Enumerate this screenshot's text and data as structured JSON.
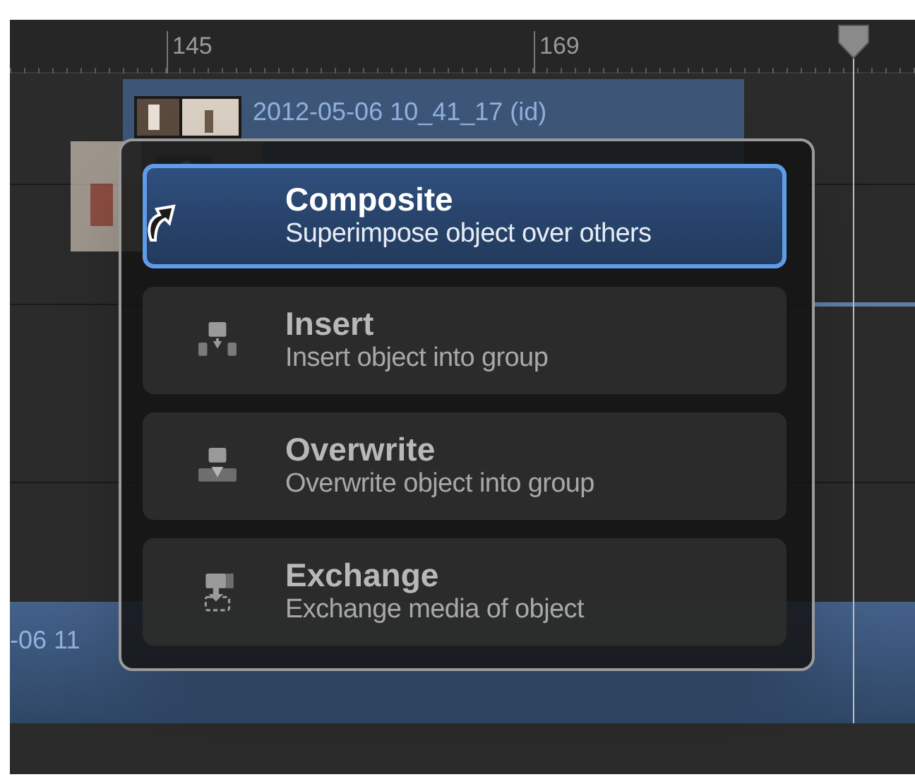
{
  "ruler": {
    "labels": [
      {
        "text": "145"
      },
      {
        "text": "169"
      }
    ]
  },
  "clips": [
    {
      "label": "2012-05-06 10_41_17 (id)"
    },
    {
      "label": "-06 11"
    }
  ],
  "menu": {
    "items": [
      {
        "kind": "composite",
        "title": "Composite",
        "description": "Superimpose object over others",
        "selected": true
      },
      {
        "kind": "insert",
        "title": "Insert",
        "description": "Insert object into group",
        "selected": false
      },
      {
        "kind": "overwrite",
        "title": "Overwrite",
        "description": "Overwrite object into group",
        "selected": false
      },
      {
        "kind": "exchange",
        "title": "Exchange",
        "description": "Exchange media of object",
        "selected": false
      }
    ]
  }
}
